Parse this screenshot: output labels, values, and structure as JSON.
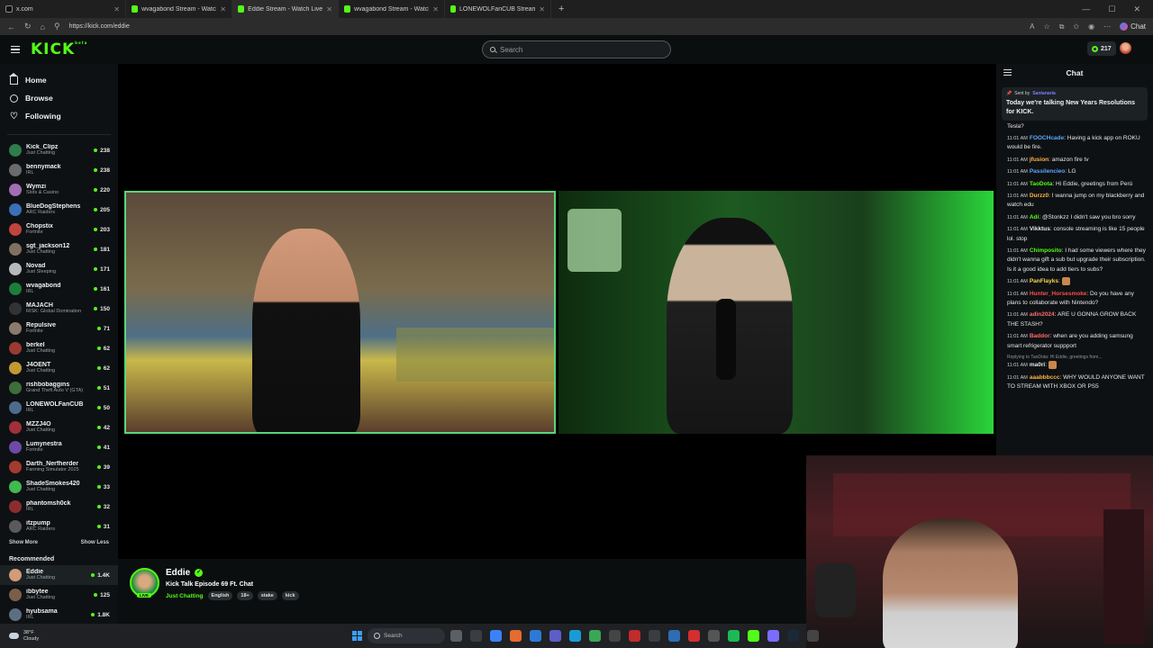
{
  "browser": {
    "tabs": [
      {
        "label": "x.com",
        "kind": "x",
        "active": false
      },
      {
        "label": "wvagabond Stream - Watch Li",
        "kind": "kick",
        "active": false
      },
      {
        "label": "Eddie Stream - Watch Live on",
        "kind": "kick",
        "active": true
      },
      {
        "label": "wvagabond Stream - Watch Li",
        "kind": "kick",
        "active": false
      },
      {
        "label": "LONEWOLFanCUB Stream - Watch",
        "kind": "kick",
        "active": false
      }
    ],
    "new_tab": "+",
    "url": "https://kick.com/eddie",
    "chat_button": "Chat"
  },
  "header": {
    "logo": "KICK",
    "logo_sup": "beta",
    "search_placeholder": "Search",
    "points": "217"
  },
  "sidebar": {
    "nav": [
      {
        "label": "Home",
        "icon": "home-icon"
      },
      {
        "label": "Browse",
        "icon": "compass-icon"
      },
      {
        "label": "Following",
        "icon": "heart-icon"
      }
    ],
    "following": [
      {
        "name": "Kick_Clipz",
        "category": "Just Chatting",
        "viewers": "238",
        "color": "#2f7d4a"
      },
      {
        "name": "bennymack",
        "category": "IRL",
        "viewers": "238",
        "color": "#6b6b6b"
      },
      {
        "name": "Wymzi",
        "category": "Slots & Casino",
        "viewers": "220",
        "color": "#a16db3"
      },
      {
        "name": "BlueDogStephens",
        "category": "ARC Raiders",
        "viewers": "205",
        "color": "#3b6fb6"
      },
      {
        "name": "Chopstix",
        "category": "Fortnite",
        "viewers": "203",
        "color": "#c0443d"
      },
      {
        "name": "sgt_jackson12",
        "category": "Just Chatting",
        "viewers": "181",
        "color": "#807060"
      },
      {
        "name": "Novad",
        "category": "Just Sleeping",
        "viewers": "171",
        "color": "#b8b8b8"
      },
      {
        "name": "wvagabond",
        "category": "IRL",
        "viewers": "161",
        "color": "#1b7e3a"
      },
      {
        "name": "MAJACH",
        "category": "RISK: Global Domination",
        "viewers": "150",
        "color": "#333333"
      },
      {
        "name": "Repulsive",
        "category": "Fortnite",
        "viewers": "71",
        "color": "#8a7b6a"
      },
      {
        "name": "berkel",
        "category": "Just Chatting",
        "viewers": "62",
        "color": "#9b3a32"
      },
      {
        "name": "J4OENT",
        "category": "Just Chatting",
        "viewers": "62",
        "color": "#c29a34"
      },
      {
        "name": "rishbobaggins",
        "category": "Grand Theft Auto V (GTA)",
        "viewers": "51",
        "color": "#3e6e39"
      },
      {
        "name": "LONEWOLFanCUB",
        "category": "IRL",
        "viewers": "50",
        "color": "#4d6b8e"
      },
      {
        "name": "MZZJ4O",
        "category": "Just Chatting",
        "viewers": "42",
        "color": "#a0303a"
      },
      {
        "name": "Lumynestra",
        "category": "Fortnite",
        "viewers": "41",
        "color": "#6e4aa8"
      },
      {
        "name": "Darth_Nerfherder",
        "category": "Farming Simulator 2025",
        "viewers": "39",
        "color": "#a33b2e"
      },
      {
        "name": "ShadeSmokes420",
        "category": "Just Chatting",
        "viewers": "33",
        "color": "#3fb950"
      },
      {
        "name": "phantomsh0ck",
        "category": "IRL",
        "viewers": "32",
        "color": "#8b2d2d"
      },
      {
        "name": "itzpump",
        "category": "ARC Raiders",
        "viewers": "31",
        "color": "#5a5a5a"
      }
    ],
    "show_more": "Show More",
    "show_less": "Show Less",
    "recommended_title": "Recommended",
    "recommended": [
      {
        "name": "Eddie",
        "category": "Just Chatting",
        "viewers": "1.4K",
        "color": "#d39b78",
        "selected": true
      },
      {
        "name": "ibbytee",
        "category": "Just Chatting",
        "viewers": "125",
        "color": "#7b5e4a",
        "selected": false
      },
      {
        "name": "hyubsama",
        "category": "IRL",
        "viewers": "1.8K",
        "color": "#5c6f80",
        "selected": false
      }
    ]
  },
  "stream": {
    "streamer": "Eddie",
    "live": "LIVE",
    "title": "Kick Talk Episode 69 Ft. Chat",
    "category": "Just Chatting",
    "tags": [
      "English",
      "18+",
      "stake",
      "kick"
    ]
  },
  "chat": {
    "title": "Chat",
    "pinned": {
      "sent_by_label": "Sent by",
      "sender": "Santanaria",
      "text": "Today we're talking New Years Resolutions for KICK."
    },
    "messages": [
      {
        "time": "",
        "user": "",
        "text": "Tesla?",
        "color": "#e6e6e6"
      },
      {
        "time": "11:01 AM",
        "user": "FOOCHcade",
        "text": "Having a kick app on ROKU would be fire.",
        "color": "#5aa7ff"
      },
      {
        "time": "11:01 AM",
        "user": "jfusion",
        "text": "amazon fire tv",
        "color": "#ffb347"
      },
      {
        "time": "11:01 AM",
        "user": "Passilencieo",
        "text": "LG",
        "color": "#5aa7ff"
      },
      {
        "time": "11:01 AM",
        "user": "TaoDota",
        "text": "Hi Eddie, greetings from Perú",
        "color": "#53fc18"
      },
      {
        "time": "11:01 AM",
        "user": "Durzz0",
        "text": "I wanna jump on my blackberry and watch edu",
        "color": "#ffb347"
      },
      {
        "time": "11:01 AM",
        "user": "Adi",
        "text": "@Stonkzz I didn't saw you bro sorry",
        "color": "#53fc18"
      },
      {
        "time": "11:01 AM",
        "user": "Vikktus",
        "text": "console streaming is like 15 people lol. stop",
        "color": "#e6e6e6"
      },
      {
        "time": "11:01 AM",
        "user": "Chimposito",
        "text": "I had some viewers where they didn't wanna gift a sub but upgrade their subscription. Is it a good idea to add tiers to subs?",
        "color": "#53fc18"
      },
      {
        "time": "11:01 AM",
        "user": "PanFlayks",
        "text": "",
        "color": "#ffd34d"
      },
      {
        "time": "11:01 AM",
        "user": "Hunter_Horsesmoke",
        "text": "Do you have any plans to collaborate with Nintendo?",
        "color": "#ff4d4d"
      },
      {
        "time": "11:01 AM",
        "user": "adin2024",
        "text": "ARE U GONNA GROW BACK THE STASH?",
        "color": "#ff6b6b"
      },
      {
        "time": "11:01 AM",
        "user": "Baddor",
        "text": "when are you adding samsung smart refrigerator suppport",
        "color": "#ff6b6b"
      },
      {
        "time": "11:01 AM",
        "user": "ma0ri",
        "text": "",
        "color": "#e6e6e6",
        "reply": "Replying to TaoDota: Hi Eddie, greetings from..."
      },
      {
        "time": "11:01 AM",
        "user": "aaabbbccc",
        "text": "WHY WOULD ANYONE WANT TO STREAM WITH XBOX OR PS5",
        "color": "#ffb347"
      }
    ]
  },
  "taskbar": {
    "temp": "38°F",
    "weather": "Cloudy",
    "search": "Search"
  }
}
